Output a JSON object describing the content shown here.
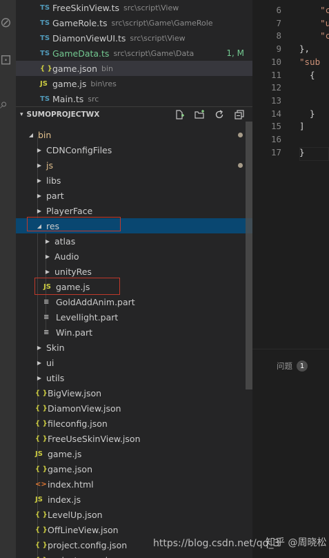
{
  "open_editors": [
    {
      "icon": "TS",
      "icon_color": "#519aba",
      "name": "FreeSkinView.ts",
      "desc": "src\\script\\View"
    },
    {
      "icon": "TS",
      "icon_color": "#519aba",
      "name": "GameRole.ts",
      "desc": "src\\script\\Game\\GameRole"
    },
    {
      "icon": "TS",
      "icon_color": "#519aba",
      "name": "DiamonViewUI.ts",
      "desc": "src\\script\\View"
    },
    {
      "icon": "TS",
      "icon_color": "#519aba",
      "name": "GameData.ts",
      "desc": "src\\script\\Game\\Data",
      "status": "1, M",
      "modified": true
    },
    {
      "icon": "{ }",
      "icon_color": "#cbcb41",
      "name": "game.json",
      "desc": "bin",
      "active": true
    },
    {
      "icon": "JS",
      "icon_color": "#cbcb41",
      "name": "game.js",
      "desc": "bin\\res"
    },
    {
      "icon": "TS",
      "icon_color": "#519aba",
      "name": "Main.ts",
      "desc": "src"
    }
  ],
  "explorer": {
    "section_title": "SUMOPROJECTWX",
    "items": [
      {
        "label": "bin",
        "kind": "folder",
        "open": true,
        "depth": 0,
        "dot": true,
        "label_color": "#e2c08d"
      },
      {
        "label": "CDNConfigFiles",
        "kind": "folder",
        "open": false,
        "depth": 1
      },
      {
        "label": "js",
        "kind": "folder",
        "open": false,
        "depth": 1,
        "dot": true,
        "label_color": "#e2c08d"
      },
      {
        "label": "libs",
        "kind": "folder",
        "open": false,
        "depth": 1
      },
      {
        "label": "part",
        "kind": "folder",
        "open": false,
        "depth": 1
      },
      {
        "label": "PlayerFace",
        "kind": "folder",
        "open": false,
        "depth": 1
      },
      {
        "label": "res",
        "kind": "folder",
        "open": true,
        "depth": 1,
        "selected": true
      },
      {
        "label": "atlas",
        "kind": "folder",
        "open": false,
        "depth": 2
      },
      {
        "label": "Audio",
        "kind": "folder",
        "open": false,
        "depth": 2
      },
      {
        "label": "unityRes",
        "kind": "folder",
        "open": false,
        "depth": 2
      },
      {
        "label": "game.js",
        "kind": "js",
        "depth": 2
      },
      {
        "label": "GoldAddAnim.part",
        "kind": "text",
        "depth": 2
      },
      {
        "label": "Levellight.part",
        "kind": "text",
        "depth": 2
      },
      {
        "label": "Win.part",
        "kind": "text",
        "depth": 2
      },
      {
        "label": "Skin",
        "kind": "folder",
        "open": false,
        "depth": 1
      },
      {
        "label": "ui",
        "kind": "folder",
        "open": false,
        "depth": 1
      },
      {
        "label": "utils",
        "kind": "folder",
        "open": false,
        "depth": 1
      },
      {
        "label": "BigView.json",
        "kind": "json",
        "depth": 1
      },
      {
        "label": "DiamonView.json",
        "kind": "json",
        "depth": 1
      },
      {
        "label": "fileconfig.json",
        "kind": "json",
        "depth": 1
      },
      {
        "label": "FreeUseSkinView.json",
        "kind": "json",
        "depth": 1
      },
      {
        "label": "game.js",
        "kind": "js",
        "depth": 1
      },
      {
        "label": "game.json",
        "kind": "json",
        "depth": 1
      },
      {
        "label": "index.html",
        "kind": "html",
        "depth": 1
      },
      {
        "label": "index.js",
        "kind": "js",
        "depth": 1
      },
      {
        "label": "LevelUp.json",
        "kind": "json",
        "depth": 1
      },
      {
        "label": "OffLineView.json",
        "kind": "json",
        "depth": 1
      },
      {
        "label": "project.config.json",
        "kind": "json",
        "depth": 1
      },
      {
        "label": "project.swan.json",
        "kind": "json",
        "depth": 1
      }
    ]
  },
  "icons": {
    "json": "{ }",
    "js": "JS",
    "html": "<>",
    "text": "≡",
    "open": "◢",
    "closed": "▶"
  },
  "editor": {
    "lines": [
      {
        "n": "6",
        "text": "    \"c"
      },
      {
        "n": "7",
        "text": "    \"u"
      },
      {
        "n": "8",
        "text": "    \"c"
      },
      {
        "n": "9",
        "text": "},"
      },
      {
        "n": "10",
        "text": "\"sub"
      },
      {
        "n": "11",
        "text": "  {"
      },
      {
        "n": "12",
        "text": ""
      },
      {
        "n": "13",
        "text": ""
      },
      {
        "n": "14",
        "text": "  }"
      },
      {
        "n": "15",
        "text": "]"
      },
      {
        "n": "16",
        "text": ""
      },
      {
        "n": "17",
        "text": "}"
      }
    ]
  },
  "panel": {
    "tab_label": "问题",
    "badge_count": "1"
  },
  "watermark": {
    "url": "https://blog.csdn.net/qq_3",
    "cn": "知乎 @周晓松"
  }
}
